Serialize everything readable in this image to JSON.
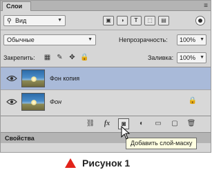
{
  "panel": {
    "tab_label": "Слои",
    "menu_icon": "panel-menu-icon"
  },
  "filter": {
    "kind_label": "Вид",
    "icons": [
      "pixel-filter-icon",
      "adjustment-filter-icon",
      "type-filter-icon",
      "shape-filter-icon",
      "smart-object-filter-icon"
    ],
    "icon_glyphs": [
      "▣",
      "◑",
      "T",
      "⬚",
      "▤"
    ]
  },
  "blend": {
    "mode": "Обычные",
    "opacity_label": "Непрозрачность:",
    "opacity_value": "100%"
  },
  "lock": {
    "label": "Закрепить:",
    "fill_label": "Заливка:",
    "fill_value": "100%"
  },
  "layers": [
    {
      "name": "Фон копия",
      "selected": true,
      "visible": true,
      "locked": false
    },
    {
      "name": "Фон",
      "selected": false,
      "visible": true,
      "locked": true
    }
  ],
  "bottom_icons": [
    {
      "name": "link-layers-icon",
      "glyph": "⛓"
    },
    {
      "name": "fx-icon",
      "glyph": "fx"
    },
    {
      "name": "add-mask-icon",
      "glyph": "◙"
    },
    {
      "name": "adjustment-layer-icon",
      "glyph": "◐"
    },
    {
      "name": "group-folder-icon",
      "glyph": "▭"
    },
    {
      "name": "new-layer-icon",
      "glyph": "▢"
    },
    {
      "name": "trash-icon",
      "glyph": "🗑"
    }
  ],
  "properties": {
    "tab_label": "Свойства"
  },
  "tooltip": "Добавить слой-маску",
  "caption": {
    "text": "Рисунок 1",
    "marker_color": "#e2231a"
  },
  "colors": {
    "selected_row": "#a9bad9",
    "panel_bg": "#d6d6d6"
  }
}
